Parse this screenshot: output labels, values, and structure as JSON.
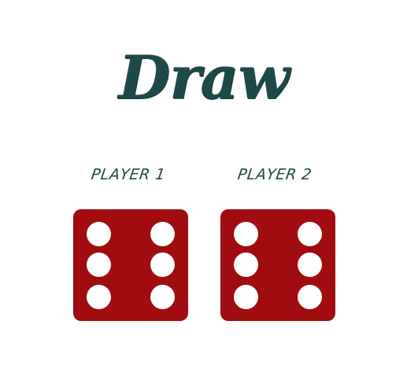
{
  "result": {
    "title": "Draw"
  },
  "players": [
    {
      "label": "PLAYER 1",
      "die_value": 6
    },
    {
      "label": "PLAYER 2",
      "die_value": 6
    }
  ],
  "colors": {
    "title_text": "#1c4a49",
    "die_face": "#a00c10",
    "pip": "#ffffff",
    "background": "#ffffff"
  }
}
